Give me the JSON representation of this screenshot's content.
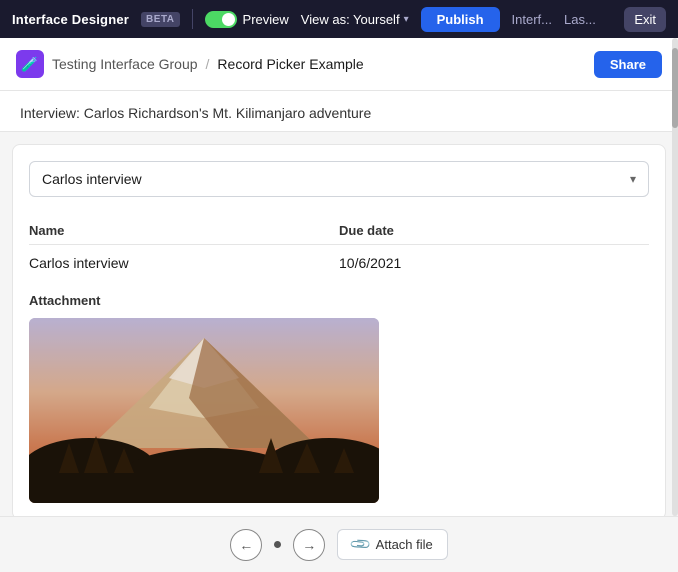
{
  "topNav": {
    "appTitle": "Interface Designer",
    "betaLabel": "BETA",
    "previewLabel": "Preview",
    "viewAsLabel": "View as: Yourself",
    "publishLabel": "Publish",
    "interfLabel": "Interf...",
    "lasLabel": "Las...",
    "exitLabel": "Exit"
  },
  "breadcrumb": {
    "icon": "🧪",
    "groupLabel": "Testing Interface Group",
    "separator": "/",
    "pageLabel": "Record Picker Example",
    "shareLabel": "Share"
  },
  "recordHeader": {
    "text": "Interview: Carlos Richardson's Mt. Kilimanjaro adventure"
  },
  "picker": {
    "selectedValue": "Carlos interview"
  },
  "fields": {
    "nameHeader": "Name",
    "dueDateHeader": "Due date",
    "nameValue": "Carlos interview",
    "dueDateValue": "10/6/2021"
  },
  "attachment": {
    "label": "Attachment",
    "altText": "Mt. Kilimanjaro photo"
  },
  "bottomBar": {
    "prevIcon": "←",
    "nextIcon": "→",
    "attachLabel": "Attach file",
    "attachIcon": "📎"
  }
}
